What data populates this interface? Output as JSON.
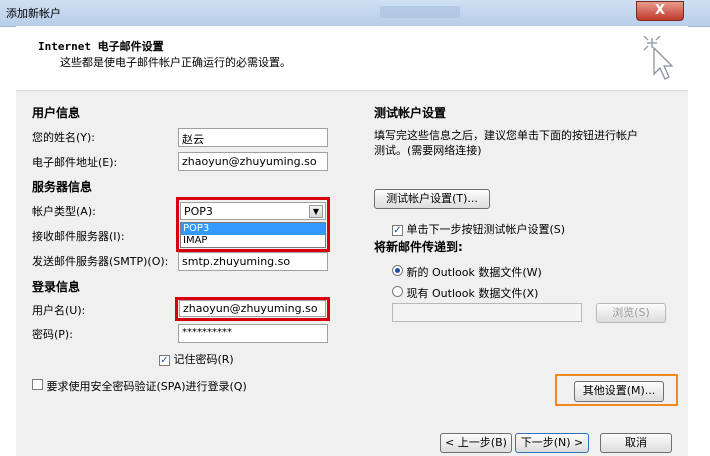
{
  "window": {
    "title": "添加新帐户",
    "close_label": "X"
  },
  "header": {
    "title": "Internet 电子邮件设置",
    "subtitle": "这些都是使电子邮件帐户正确运行的必需设置。"
  },
  "user_info": {
    "section": "用户信息",
    "name_label": "您的姓名(Y):",
    "name_value": "赵云",
    "email_label": "电子邮件地址(E):",
    "email_value": "zhaoyun@zhuyuming.so"
  },
  "server_info": {
    "section": "服务器信息",
    "account_type_label": "帐户类型(A):",
    "account_type_value": "POP3",
    "account_type_options": [
      "POP3",
      "IMAP"
    ],
    "incoming_label": "接收邮件服务器(I):",
    "outgoing_label": "发送邮件服务器(SMTP)(O):",
    "outgoing_value": "smtp.zhuyuming.so"
  },
  "login_info": {
    "section": "登录信息",
    "username_label": "用户名(U):",
    "username_value": "zhaoyun@zhuyuming.so",
    "password_label": "密码(P):",
    "password_value": "**********",
    "remember_label": "记住密码(R)",
    "remember_checked": true,
    "spa_label": "要求使用安全密码验证(SPA)进行登录(Q)",
    "spa_checked": false
  },
  "test": {
    "section": "测试帐户设置",
    "desc_line1": "填写完这些信息之后，建议您单击下面的按钮进行帐户",
    "desc_line2": "测试。(需要网络连接)",
    "test_button": "测试帐户设置(T)...",
    "next_test_label": "单击下一步按钮测试帐户设置(S)",
    "next_test_checked": true
  },
  "deliver": {
    "section": "将新邮件传递到:",
    "new_file_label": "新的 Outlook 数据文件(W)",
    "existing_file_label": "现有 Outlook 数据文件(X)",
    "selected": "new",
    "browse_button": "浏览(S)"
  },
  "buttons": {
    "more_settings": "其他设置(M)...",
    "back": "< 上一步(B)",
    "next": "下一步(N) >",
    "cancel": "取消"
  },
  "colors": {
    "highlight_red": "#d8000f",
    "highlight_orange": "#f08a1c",
    "selection": "#3399ff"
  },
  "icons": {
    "header": "magic-wand-cursor-icon"
  }
}
